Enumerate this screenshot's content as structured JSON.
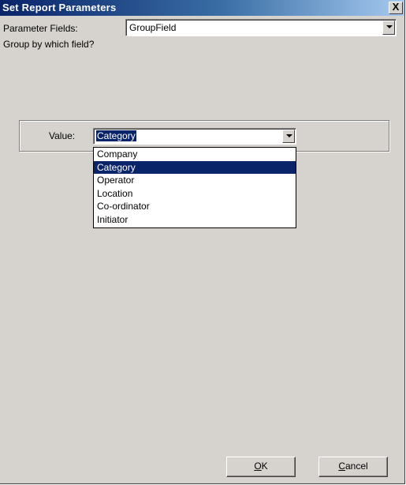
{
  "window": {
    "title": "Set Report Parameters",
    "close_glyph": "X"
  },
  "parameter_fields": {
    "label": "Parameter Fields:",
    "selected": "GroupField"
  },
  "prompt_text": "Group by which field?",
  "value": {
    "label": "Value:",
    "selected": "Category",
    "options": [
      "Company",
      "Category",
      "Operator",
      "Location",
      "Co-ordinator",
      "Initiator"
    ],
    "selected_index": 1
  },
  "buttons": {
    "ok_mnemonic": "O",
    "ok_rest": "K",
    "cancel_mnemonic": "C",
    "cancel_rest": "ancel"
  }
}
